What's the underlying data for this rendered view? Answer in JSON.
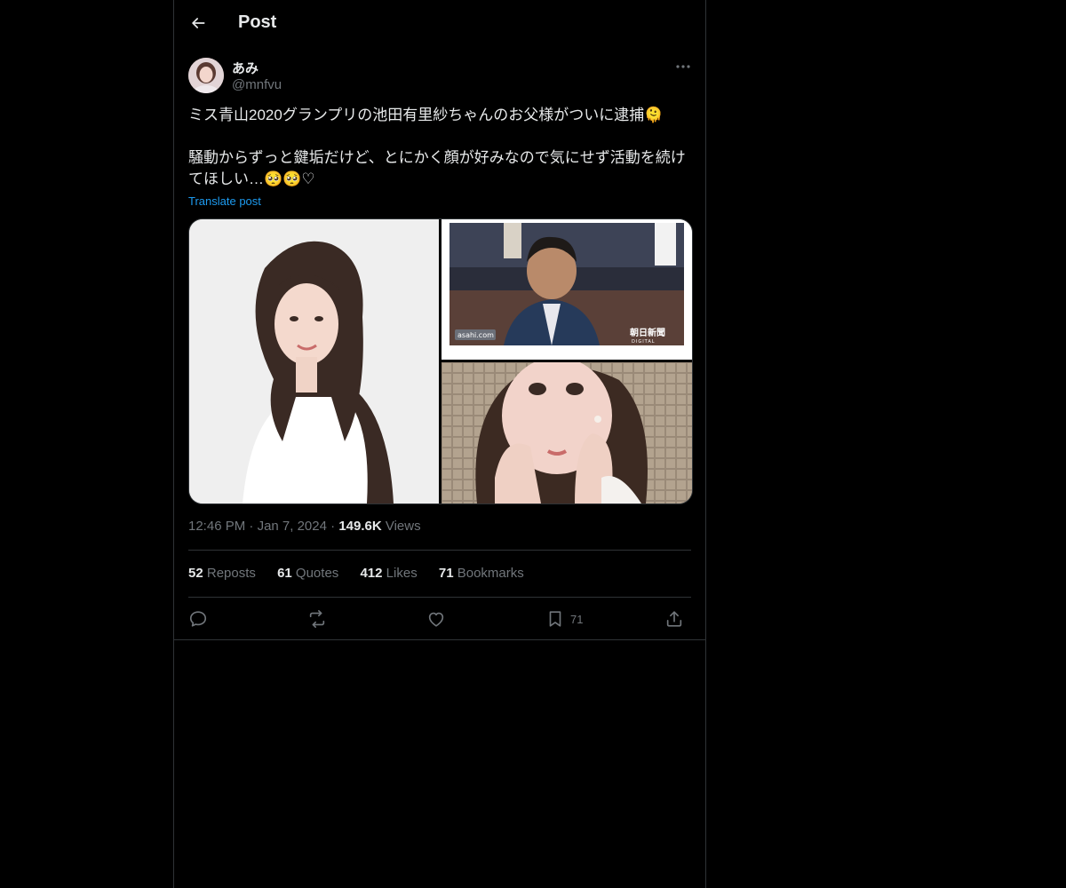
{
  "header": {
    "title": "Post"
  },
  "author": {
    "display_name": "あみ",
    "handle": "@mnfvu"
  },
  "post": {
    "line1": "ミス青山2020グランプリの池田有里紗ちゃんのお父様がついに逮捕🫠",
    "line2": "騒動からずっと鍵垢だけど、とにかく顔が好みなので気にせず活動を続けてほしい…🥺🥺♡",
    "translate_label": "Translate post"
  },
  "media": {
    "watermark_left": "asahi.com",
    "watermark_right": "朝日新聞",
    "watermark_right_sub": "DIGITAL"
  },
  "meta": {
    "time": "12:46 PM",
    "date": "Jan 7, 2024",
    "views_count": "149.6K",
    "views_label": "Views"
  },
  "stats": {
    "reposts_count": "52",
    "reposts_label": "Reposts",
    "quotes_count": "61",
    "quotes_label": "Quotes",
    "likes_count": "412",
    "likes_label": "Likes",
    "bookmarks_count": "71",
    "bookmarks_label": "Bookmarks"
  },
  "actions": {
    "bookmark_count": "71"
  },
  "icons": {
    "back": "arrow-left-icon",
    "more": "more-horizontal-icon",
    "reply": "reply-icon",
    "repost": "repost-icon",
    "like": "heart-icon",
    "bookmark": "bookmark-icon",
    "share": "share-icon"
  },
  "colors": {
    "background": "#000000",
    "text": "#e7e9ea",
    "secondary": "#71767b",
    "link": "#1d9bf0",
    "border": "#2f3336"
  }
}
